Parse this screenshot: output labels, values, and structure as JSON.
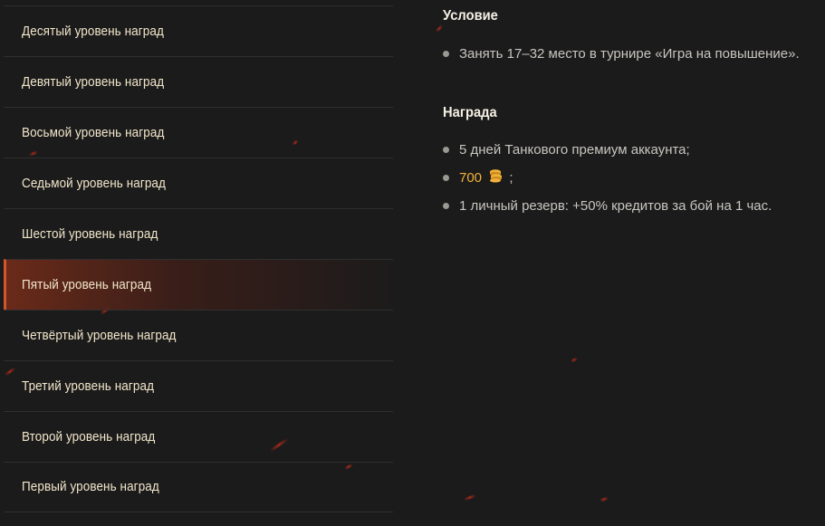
{
  "sidebar": {
    "items": [
      {
        "label": "Десятый уровень наград"
      },
      {
        "label": "Девятый уровень наград"
      },
      {
        "label": "Восьмой уровень наград"
      },
      {
        "label": "Седьмой уровень наград"
      },
      {
        "label": "Шестой уровень наград"
      },
      {
        "label": "Пятый уровень наград"
      },
      {
        "label": "Четвёртый уровень наград"
      },
      {
        "label": "Третий уровень наград"
      },
      {
        "label": "Второй уровень наград"
      },
      {
        "label": "Первый уровень наград"
      }
    ],
    "active_index": 5,
    "active_accent": "#d2562a"
  },
  "condition": {
    "title": "Условие",
    "items": [
      "Занять 17–32 место в турнире «Игра на повышение»."
    ]
  },
  "reward": {
    "title": "Награда",
    "premium": "5 дней Танкового премиум аккаунта;",
    "gold_amount": "700",
    "gold_icon": "gold-coins-icon",
    "gold_suffix": ";",
    "reserve": "1 личный резерв: +50% кредитов за бой на 1 час."
  },
  "colors": {
    "background": "#1b1b1c",
    "text_primary": "#f2e6c9",
    "gold": "#f3b23a"
  }
}
